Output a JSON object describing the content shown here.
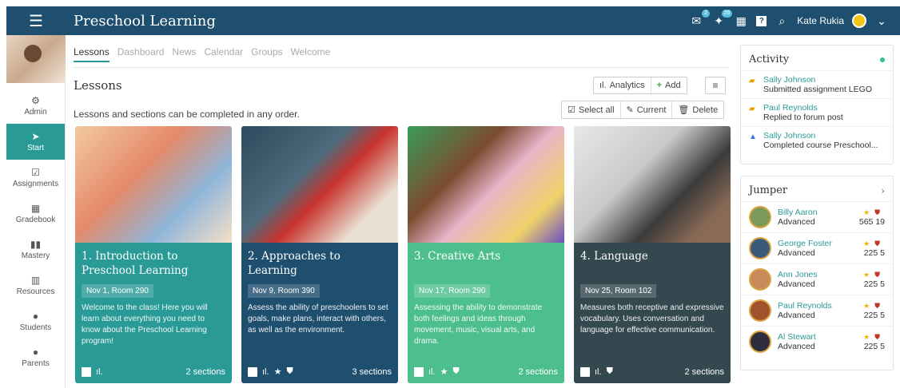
{
  "app": {
    "title": "Preschool Learning"
  },
  "topbar": {
    "notif_count_1": "2",
    "notif_count_2": "26",
    "user_name": "Kate Rukia"
  },
  "sidebar": {
    "items": [
      {
        "label": "Admin",
        "icon": "gear-icon"
      },
      {
        "label": "Start",
        "icon": "arrow-icon"
      },
      {
        "label": "Assignments",
        "icon": "check-icon"
      },
      {
        "label": "Gradebook",
        "icon": "grid-icon"
      },
      {
        "label": "Mastery",
        "icon": "bars-icon"
      },
      {
        "label": "Resources",
        "icon": "books-icon"
      },
      {
        "label": "Students",
        "icon": "person-icon"
      },
      {
        "label": "Parents",
        "icon": "person-icon"
      }
    ]
  },
  "tabs": [
    "Lessons",
    "Dashboard",
    "News",
    "Calendar",
    "Groups",
    "Welcome"
  ],
  "main": {
    "title": "Lessons",
    "subtitle": "Lessons and sections can be completed in any order.",
    "analytics_label": "Analytics",
    "add_label": "Add",
    "select_all_label": "Select all",
    "current_label": "Current",
    "delete_label": "Delete"
  },
  "cards": [
    {
      "title": "1. Introduction to Preschool Learning",
      "date": "Nov 1, Room 290",
      "desc": "Welcome to the class! Here you will learn about everything you need to know about the Preschool Learning program!",
      "count": "2 sections",
      "color": "#2a9a97"
    },
    {
      "title": "2. Approaches to Learning",
      "date": "Nov 9, Room 390",
      "desc": "Assess the ability of preschoolers to set goals, make plans, interact with others, as well as the environment.",
      "count": "3 sections",
      "color": "#1f4f6e"
    },
    {
      "title": "3. Creative Arts",
      "date": "Nov 17, Room 290",
      "desc": "Assessing the ability to demonstrate both feelings and ideas through movement, music, visual arts, and drama.",
      "count": "2 sections",
      "color": "#4dbf8e"
    },
    {
      "title": "4. Language",
      "date": "Nov 25, Room 102",
      "desc": "Measures both receptive and expressive vocabulary. Uses conversation and language for effective communication.",
      "count": "2 sections",
      "color": "#33484f"
    }
  ],
  "activity": {
    "title": "Activity",
    "items": [
      {
        "name": "Sally Johnson",
        "text": "Submitted assignment LEGO"
      },
      {
        "name": "Paul Reynolds",
        "text": "Replied to forum post"
      },
      {
        "name": "Sally Johnson",
        "text": "Completed course Preschool..."
      }
    ]
  },
  "jumper": {
    "title": "Jumper",
    "items": [
      {
        "name": "Billy Aaron",
        "level": "Advanced",
        "points": "565",
        "badges": "19"
      },
      {
        "name": "George Foster",
        "level": "Advanced",
        "points": "225",
        "badges": "5"
      },
      {
        "name": "Ann Jones",
        "level": "Advanced",
        "points": "225",
        "badges": "5"
      },
      {
        "name": "Paul Reynolds",
        "level": "Advanced",
        "points": "225",
        "badges": "5"
      },
      {
        "name": "Al Stewart",
        "level": "Advanced",
        "points": "225",
        "badges": "5"
      }
    ]
  }
}
